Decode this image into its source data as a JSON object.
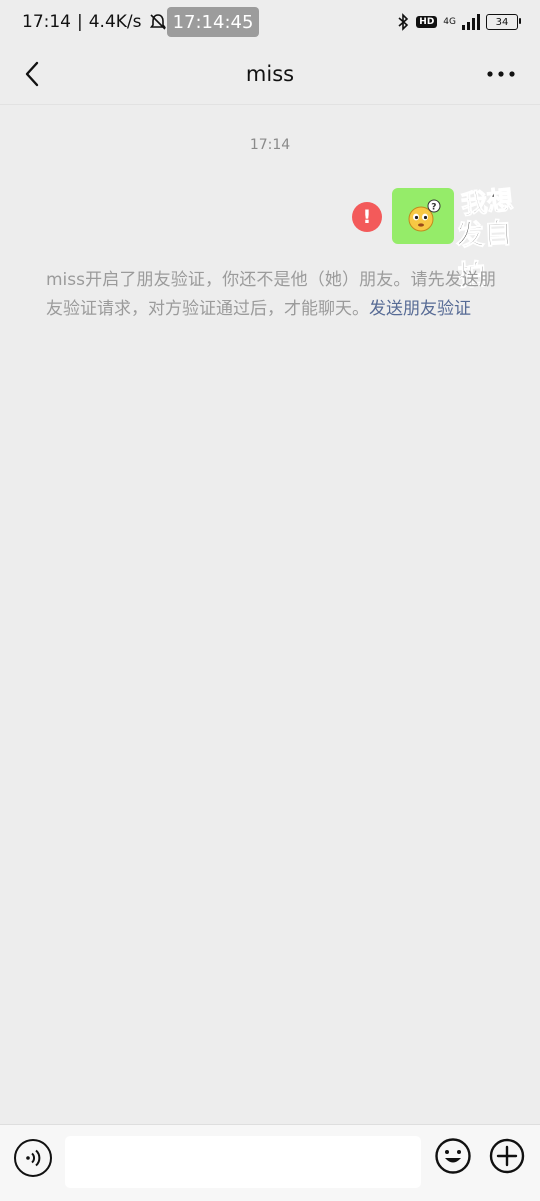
{
  "status_bar": {
    "time": "17:14",
    "net_speed": "4.4K/s",
    "clock_overlay": "17:14:45",
    "network": "4G",
    "hd": "HD",
    "battery": "34"
  },
  "header": {
    "title": "miss"
  },
  "chat": {
    "timestamp": "17:14",
    "sticker_line1": "我想",
    "sticker_line2": "发自拍",
    "system_message": "miss开启了朋友验证，你还不是他（她）朋友。请先发送朋友验证请求，对方验证通过后，才能聊天。",
    "system_link": "发送朋友验证",
    "error_symbol": "!"
  },
  "input_bar": {
    "placeholder": ""
  },
  "colors": {
    "bubble_green": "#95ec69",
    "error_red": "#f35a5a",
    "link_blue": "#576b95"
  },
  "icons": {
    "back": "chevron-left-icon",
    "more": "more-dots-icon",
    "voice": "voice-icon",
    "emoji": "emoji-icon",
    "plus": "plus-icon",
    "bluetooth": "bluetooth-icon",
    "mute": "bell-off-icon",
    "signal": "signal-icon"
  }
}
